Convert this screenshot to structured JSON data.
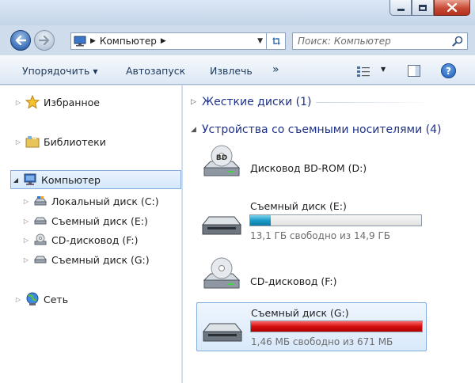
{
  "window": {
    "minimize_icon": "minimize-icon",
    "maximize_icon": "maximize-icon",
    "close_icon": "close-icon"
  },
  "address": {
    "path": "Компьютер",
    "search_placeholder": "Поиск: Компьютер"
  },
  "toolbar": {
    "organize": "Упорядочить",
    "autoplay": "Автозапуск",
    "eject": "Извлечь",
    "more": "»",
    "help": "?"
  },
  "nav": {
    "favorites": "Избранное",
    "libraries": "Библиотеки",
    "computer": "Компьютер",
    "local_c": "Локальный диск (C:)",
    "removable_e": "Съемный диск (E:)",
    "cd_f": "CD-дисковод (F:)",
    "removable_g": "Съемный диск (G:)",
    "network": "Сеть"
  },
  "content": {
    "group_hdd": "Жесткие диски (1)",
    "group_removable": "Устройства со съемными носителями (4)",
    "drives": [
      {
        "name": "Дисковод BD-ROM (D:)",
        "icon": "bd-rom-drive-icon"
      },
      {
        "name": "Съемный диск (E:)",
        "free": "13,1 ГБ свободно из 14,9 ГБ",
        "used_fraction": 0.12,
        "icon": "removable-drive-icon"
      },
      {
        "name": "CD-дисковод (F:)",
        "icon": "cd-drive-icon"
      },
      {
        "name": "Съемный диск (G:)",
        "free": "1,46 МБ свободно из 671 МБ",
        "used_fraction": 0.998,
        "icon": "removable-drive-icon"
      }
    ]
  },
  "colors": {
    "bar_normal": "#1a9cc8",
    "bar_full": "#d40f0f",
    "group_header": "#1e3287"
  }
}
